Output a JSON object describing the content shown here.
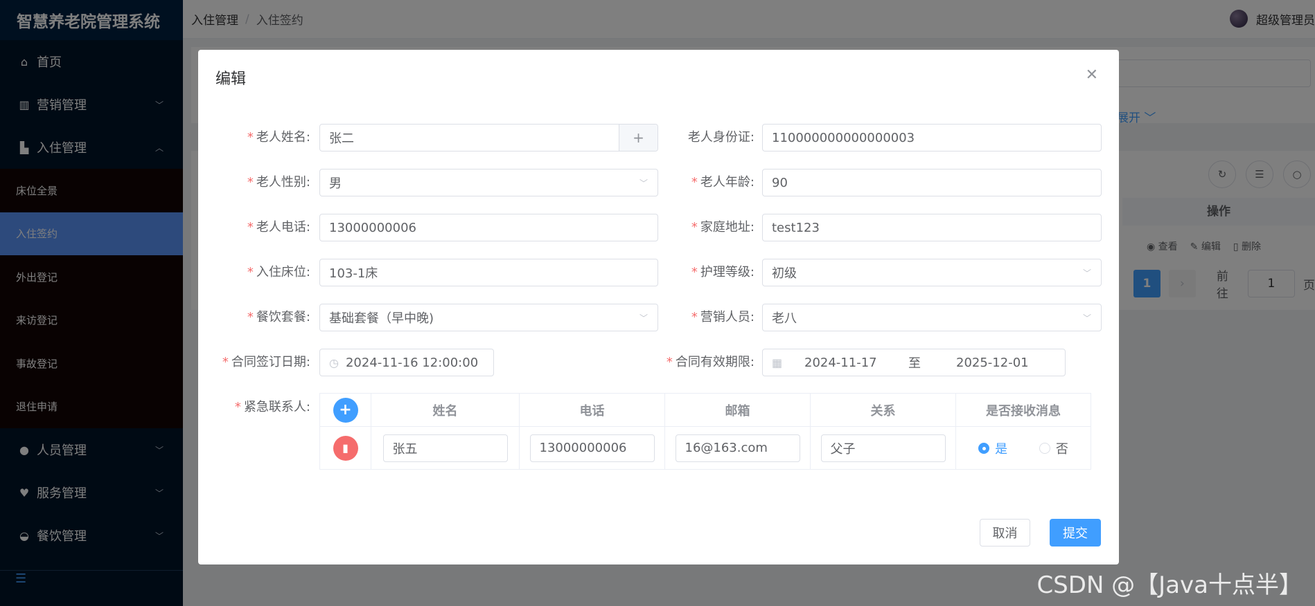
{
  "app": {
    "title": "智慧养老院管理系统"
  },
  "sidebar": {
    "items": [
      {
        "label": "首页",
        "icon": "home-icon"
      },
      {
        "label": "营销管理",
        "icon": "chart-icon"
      },
      {
        "label": "入住管理",
        "icon": "building-icon"
      }
    ],
    "submenu": [
      {
        "label": "床位全景"
      },
      {
        "label": "入住签约"
      },
      {
        "label": "外出登记"
      },
      {
        "label": "来访登记"
      },
      {
        "label": "事故登记"
      },
      {
        "label": "退住申请"
      }
    ],
    "items_after": [
      {
        "label": "人员管理",
        "icon": "user-icon"
      },
      {
        "label": "服务管理",
        "icon": "heart-icon"
      },
      {
        "label": "餐饮管理",
        "icon": "bowl-icon"
      }
    ]
  },
  "header": {
    "breadcrumb": [
      "入住管理",
      "入住签约"
    ],
    "user": "超级管理员"
  },
  "background": {
    "expand_label": "展开",
    "ops_header": "操作",
    "ops": [
      "查看",
      "编辑",
      "删除"
    ],
    "pagination": {
      "current": "1",
      "goto_label": "前往",
      "goto_value": "1",
      "unit": "页"
    }
  },
  "dialog": {
    "title": "编辑",
    "fields": {
      "elder_name": {
        "label": "老人姓名:",
        "value": "张二"
      },
      "elder_id": {
        "label": "老人身份证:",
        "value": "110000000000000003"
      },
      "gender": {
        "label": "老人性别:",
        "value": "男"
      },
      "age": {
        "label": "老人年龄:",
        "value": "90"
      },
      "phone": {
        "label": "老人电话:",
        "value": "13000000006"
      },
      "address": {
        "label": "家庭地址:",
        "value": "test123"
      },
      "bed": {
        "label": "入住床位:",
        "value": "103-1床"
      },
      "care_level": {
        "label": "护理等级:",
        "value": "初级"
      },
      "meal": {
        "label": "餐饮套餐:",
        "value": "基础套餐（早中晚)"
      },
      "sales": {
        "label": "营销人员:",
        "value": "老八"
      },
      "sign_date": {
        "label": "合同签订日期:",
        "value": "2024-11-16 12:00:00"
      },
      "contract_period": {
        "label": "合同有效期限:",
        "start": "2024-11-17",
        "separator": "至",
        "end": "2025-12-01"
      },
      "emergency": {
        "label": "紧急联系人:"
      }
    },
    "contacts_table": {
      "headers": [
        "姓名",
        "电话",
        "邮箱",
        "关系",
        "是否接收消息"
      ],
      "rows": [
        {
          "name": "张五",
          "phone": "13000000006",
          "email": "16@163.com",
          "relation": "父子",
          "yes": "是",
          "no": "否"
        }
      ]
    },
    "buttons": {
      "cancel": "取消",
      "submit": "提交"
    }
  },
  "watermark": "CSDN @【Java十点半】",
  "colors": {
    "primary": "#409eff",
    "danger": "#f56c6c",
    "sidebar": "#001529",
    "active_submenu": "#5b95f9"
  }
}
